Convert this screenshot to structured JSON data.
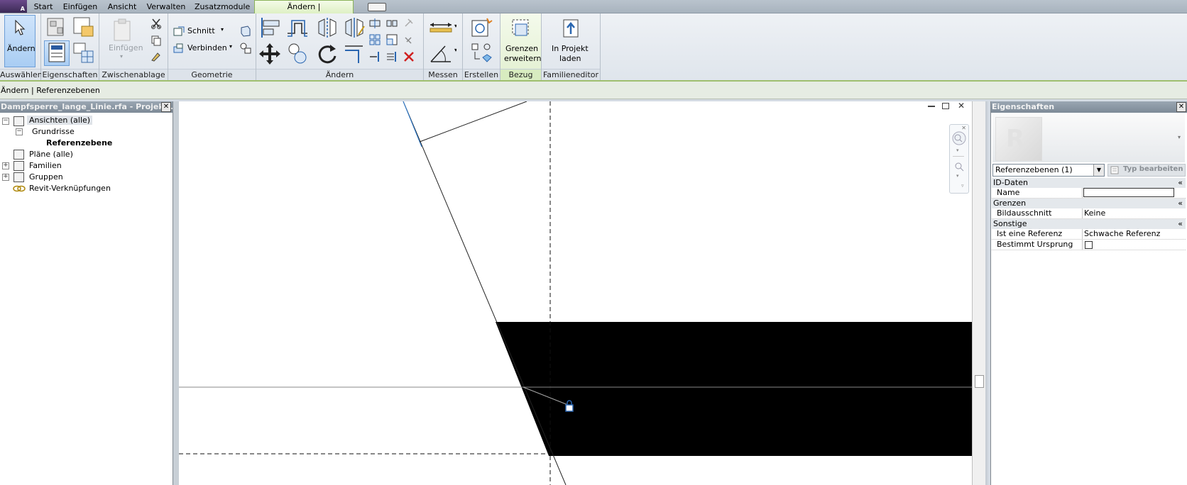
{
  "tabs": {
    "start": "Start",
    "einfuegen": "Einfügen",
    "ansicht": "Ansicht",
    "verwalten": "Verwalten",
    "zusatzmodule": "Zusatzmodule",
    "aendern_ref": "Ändern | Referenzebenen"
  },
  "app": {
    "letter": "A"
  },
  "ribbon": {
    "panels": {
      "auswaehlen": "Auswählen",
      "eigenschaften": "Eigenschaften",
      "zwischenablage": "Zwischenablage",
      "geometrie": "Geometrie",
      "aendern": "Ändern",
      "messen": "Messen",
      "erstellen": "Erstellen",
      "bezug": "Bezug",
      "familieneditor": "Familieneditor"
    },
    "aendern_btn": "Ändern",
    "einfuegen_btn": "Einfügen",
    "schnitt": "Schnitt",
    "verbinden": "Verbinden",
    "grenzen1": "Grenzen",
    "grenzen2": "erweitern",
    "inprojekt1": "In Projekt",
    "inprojekt2": "laden"
  },
  "options_bar": {
    "context": "Ändern | Referenzebenen"
  },
  "browser": {
    "title": "Dampfsperre_lange_Linie.rfa - Projekt...",
    "items": {
      "ansichten": "Ansichten (alle)",
      "grundrisse": "Grundrisse",
      "referenzebene": "Referenzebene",
      "plaene": "Pläne (alle)",
      "familien": "Familien",
      "gruppen": "Gruppen",
      "revit_verkn": "Revit-Verknüpfungen"
    }
  },
  "properties": {
    "title": "Eigenschaften",
    "type_selector": "Referenzebenen (1)",
    "edit_type": "Typ bearbeiten",
    "groups": {
      "id": "ID-Daten",
      "grenzen": "Grenzen",
      "sonstige": "Sonstige"
    },
    "rows": {
      "name_k": "Name",
      "name_v": "",
      "bild_k": "Bildausschnitt",
      "bild_v": "Keine",
      "ref_k": "Ist eine Referenz",
      "ref_v": "Schwache Referenz",
      "urs_k": "Bestimmt Ursprung"
    }
  }
}
